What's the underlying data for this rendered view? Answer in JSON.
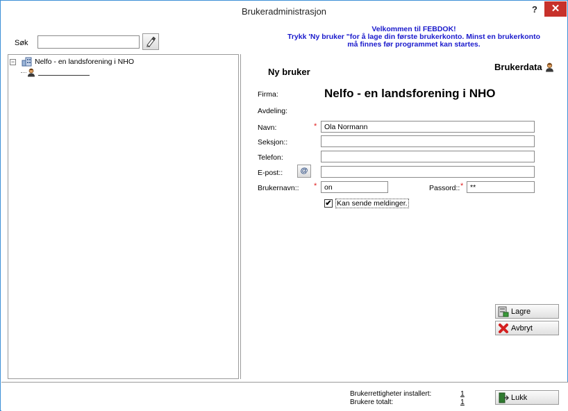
{
  "window": {
    "title": "Brukeradministrasjon",
    "help_label": "?",
    "close_label": "✕"
  },
  "welcome": {
    "line1": "Velkommen til FEBDOK!",
    "line2": "Trykk 'Ny bruker \"for å lage din første brukerkonto. Minst en brukerkonto",
    "line3": "må finnes før programmet kan startes."
  },
  "search": {
    "label": "Søk",
    "value": "",
    "button_icon": "eraser-icon"
  },
  "tree": {
    "root_expander": "−",
    "root_label": "Nelfo - en landsforening i NHO",
    "root_icon": "organization-icon",
    "child_icon": "user-icon",
    "child_label": ""
  },
  "form": {
    "title": "Ny bruker",
    "heading": "Brukerdata",
    "heading_icon": "user-icon",
    "firma_label": "Firma:",
    "firma_value": "Nelfo - en landsforening i NHO",
    "avdeling_label": "Avdeling:",
    "navn_label": "Navn:",
    "navn_value": "Ola Normann",
    "seksjon_label": "Seksjon::",
    "seksjon_value": "",
    "telefon_label": "Telefon:",
    "telefon_value": "",
    "epost_label": "E-post::",
    "epost_button": "@",
    "epost_value": "",
    "brukernavn_label": "Brukernavn::",
    "brukernavn_value": "on",
    "passord_label": "Passord::",
    "passord_value": "**",
    "required_mark": "*",
    "checkbox_label": "Kan sende meldinger.",
    "checkbox_checked": true,
    "checkbox_mark": "✔"
  },
  "buttons": {
    "save_label": "Lagre",
    "cancel_label": "Avbryt",
    "close_label": "Lukk"
  },
  "status": {
    "rights_label": "Brukerrettigheter installert:",
    "rights_value": "1",
    "users_label": "Brukere totalt:",
    "users_value": "1"
  },
  "colors": {
    "welcome_text": "#1a1acc",
    "required": "#e02020",
    "close_button": "#c7312b",
    "window_border": "#3c8fd6"
  }
}
